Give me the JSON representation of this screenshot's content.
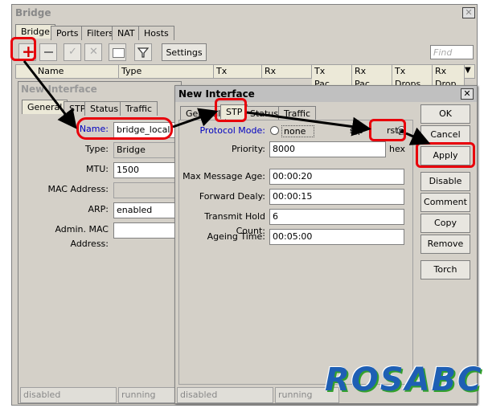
{
  "bridge_window": {
    "title": "Bridge",
    "tabs": [
      "Bridge",
      "Ports",
      "Filters",
      "NAT",
      "Hosts"
    ],
    "settings_label": "Settings",
    "find_placeholder": "Find",
    "columns": [
      "Name",
      "Type",
      "Tx",
      "Rx",
      "Tx Pac...",
      "Rx Pac...",
      "Tx Drops",
      "Rx Drop"
    ]
  },
  "back_dialog": {
    "title": "New Interface",
    "tabs": [
      "General",
      "STP",
      "Status",
      "Traffic"
    ],
    "fields": {
      "name_label": "Name:",
      "name_value": "bridge_local",
      "type_label": "Type:",
      "type_value": "Bridge",
      "mtu_label": "MTU:",
      "mtu_value": "1500",
      "mac_label": "MAC Address:",
      "mac_value": "",
      "arp_label": "ARP:",
      "arp_value": "enabled",
      "admin_mac_label": "Admin. MAC Address:",
      "admin_mac_value": ""
    },
    "status_left": "disabled",
    "status_mid": "running"
  },
  "front_dialog": {
    "title": "New Interface",
    "tabs": [
      "General",
      "STP",
      "Status",
      "Traffic"
    ],
    "protocol_mode_label": "Protocol Mode:",
    "protocol_options": [
      "none",
      "stp",
      "rstp"
    ],
    "protocol_selected": "rstp",
    "priority_label": "Priority:",
    "priority_value": "8000",
    "priority_unit": "hex",
    "max_age_label": "Max Message Age:",
    "max_age_value": "00:00:20",
    "fwd_delay_label": "Forward Dealy:",
    "fwd_delay_value": "00:00:15",
    "hold_count_label": "Transmit Hold Count:",
    "hold_count_value": "6",
    "ageing_label": "Ageing Time:",
    "ageing_value": "00:05:00",
    "buttons": [
      "OK",
      "Cancel",
      "Apply",
      "Disable",
      "Comment",
      "Copy",
      "Remove",
      "Torch"
    ],
    "status_left": "disabled",
    "status_mid": "running"
  },
  "watermark": "ROSABC",
  "colors": {
    "highlight": "#e8000b",
    "label_blue": "#0000c0",
    "watermark_blue": "#1e5fb4",
    "watermark_green": "#33a02c"
  }
}
